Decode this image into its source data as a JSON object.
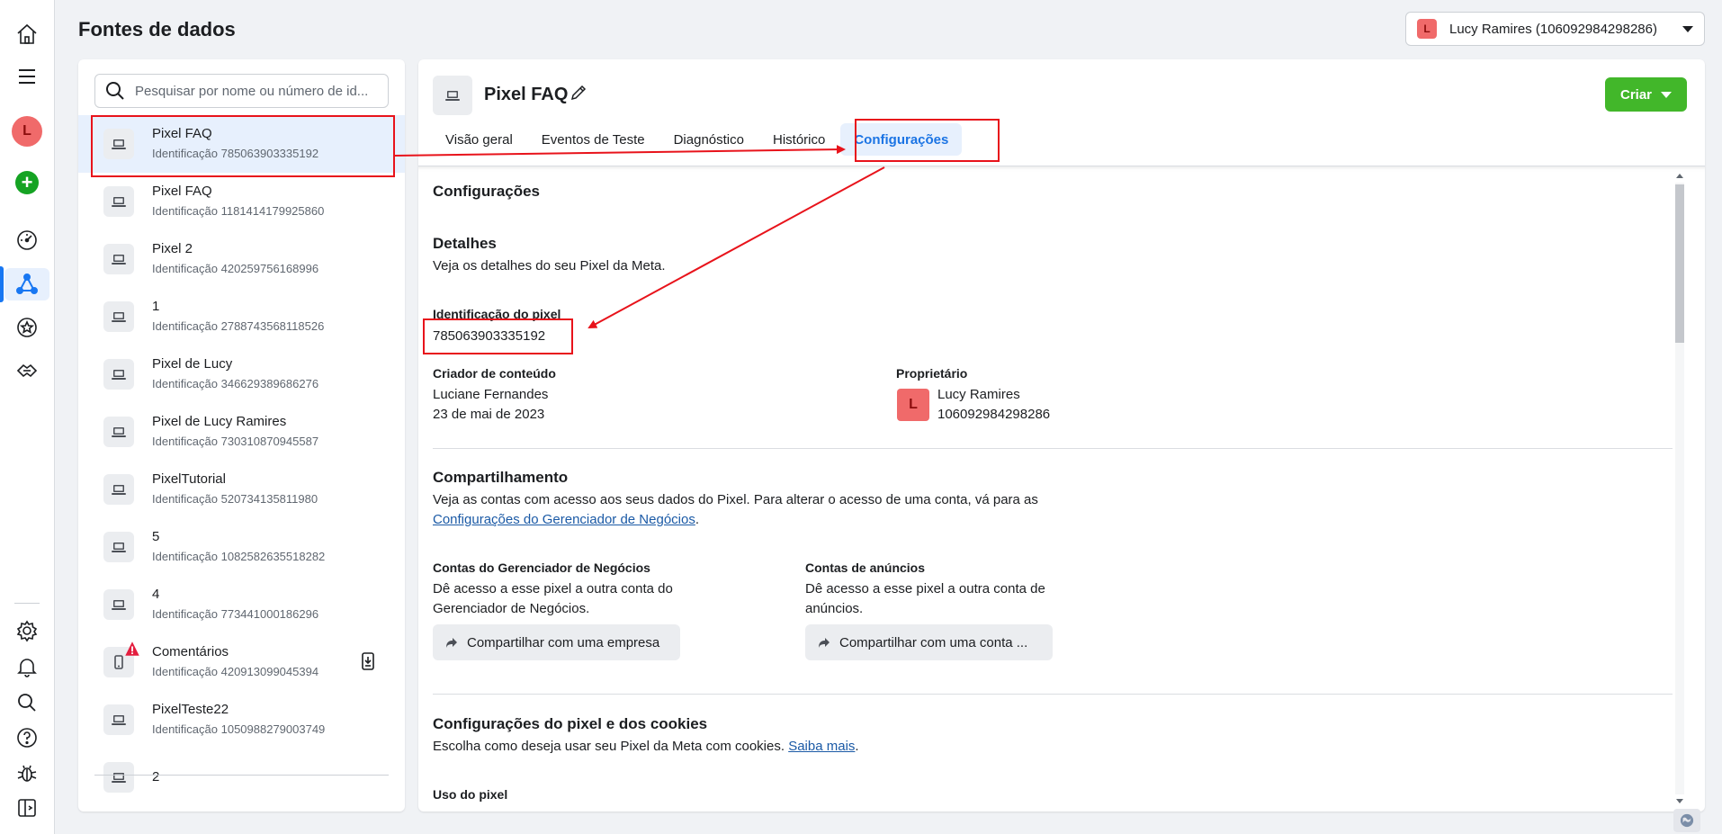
{
  "page": {
    "title": "Fontes de dados"
  },
  "account": {
    "initial": "L",
    "name": "Lucy Ramires (106092984298286)"
  },
  "nav": {
    "avatar_initial": "L",
    "icons": [
      "home-icon",
      "menu-icon",
      "avatar",
      "create-icon",
      "dashboard-icon",
      "events-manager-icon",
      "star-icon",
      "partner-icon",
      "settings-icon",
      "notifications-icon",
      "search-icon",
      "help-icon",
      "bug-icon",
      "sidebar-toggle-icon"
    ]
  },
  "search": {
    "placeholder": "Pesquisar por nome ou número de id..."
  },
  "sources": [
    {
      "name": "Pixel FAQ",
      "id": "Identificação 785063903335192",
      "device": "laptop"
    },
    {
      "name": "Pixel FAQ",
      "id": "Identificação 1181414179925860",
      "device": "laptop"
    },
    {
      "name": "Pixel 2",
      "id": "Identificação 420259756168996",
      "device": "laptop"
    },
    {
      "name": "1",
      "id": "Identificação 2788743568118526",
      "device": "laptop"
    },
    {
      "name": "Pixel de Lucy",
      "id": "Identificação 346629389686276",
      "device": "laptop"
    },
    {
      "name": "Pixel de Lucy Ramires",
      "id": "Identificação 730310870945587",
      "device": "laptop"
    },
    {
      "name": "PixelTutorial",
      "id": "Identificação 520734135811980",
      "device": "laptop"
    },
    {
      "name": "5",
      "id": "Identificação 1082582635518282",
      "device": "laptop"
    },
    {
      "name": "4",
      "id": "Identificação 773441000186296",
      "device": "laptop"
    },
    {
      "name": "Comentários",
      "id": "Identificação 420913099045394",
      "device": "phone"
    },
    {
      "name": "PixelTeste22",
      "id": "Identificação 1050988279003749",
      "device": "laptop"
    },
    {
      "name": "2",
      "id": "",
      "device": "laptop"
    }
  ],
  "detail": {
    "title": "Pixel FAQ",
    "create_label": "Criar",
    "tabs": [
      "Visão geral",
      "Eventos de Teste",
      "Diagnóstico",
      "Histórico",
      "Configurações"
    ],
    "active_tab": "Configurações",
    "section_title": "Configurações",
    "details": {
      "heading": "Detalhes",
      "desc": "Veja os detalhes do seu Pixel da Meta.",
      "pixel_id_label": "Identificação do pixel",
      "pixel_id": "785063903335192",
      "creator_label": "Criador de conteúdo",
      "creator_name": "Luciane Fernandes",
      "creator_date": "23 de mai de 2023",
      "owner_label": "Proprietário",
      "owner_initial": "L",
      "owner_name": "Lucy Ramires",
      "owner_id": "106092984298286"
    },
    "sharing": {
      "heading": "Compartilhamento",
      "desc": "Veja as contas com acesso aos seus dados do Pixel. Para alterar o acesso de uma conta, vá para as",
      "link": "Configurações do Gerenciador de Negócios",
      "link_suffix": ".",
      "bm_title": "Contas do Gerenciador de Negócios",
      "bm_desc_1": "Dê acesso a esse pixel a outra conta do",
      "bm_desc_2": "Gerenciador de Negócios.",
      "bm_button": "Compartilhar com uma empresa",
      "ads_title": "Contas de anúncios",
      "ads_desc_1": "Dê acesso a esse pixel a outra conta de",
      "ads_desc_2": "anúncios.",
      "ads_button": "Compartilhar com uma conta ..."
    },
    "cookies": {
      "heading": "Configurações do pixel e dos cookies",
      "desc": "Escolha como deseja usar seu Pixel da Meta com cookies.",
      "link": "Saiba mais",
      "link_suffix": ".",
      "next_heading": "Uso do pixel"
    }
  },
  "colors": {
    "accent": "#1877f2",
    "active_tab_text": "#1b74e4",
    "create_button": "#42b72a",
    "annotation_red": "#e8131b",
    "avatar": "#f06a6a"
  }
}
